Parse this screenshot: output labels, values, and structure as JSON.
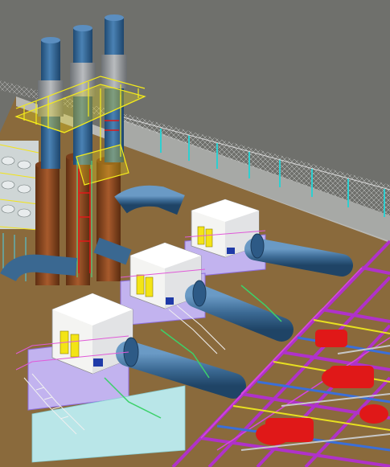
{
  "viewport": {
    "background": "#6f706c",
    "ground_color": "#8a6a3c",
    "wall_color": "#a7a9a6",
    "fence_color": "#2ecfd0",
    "stack_color": "#3a6b9a",
    "duct_color": "#3d6b95",
    "chimney_color": "#8a4a25",
    "enclosure_color": "#f4f4f2",
    "panel_color": "#f3e416",
    "handrail_color": "#f5ec1a",
    "skid_color": "#b7a1e6",
    "pipe_rack_color": "#b032c9",
    "red_equipment_color": "#e01818"
  },
  "scene": {
    "stacks": [
      "stack-1",
      "stack-2",
      "stack-3"
    ],
    "generator_units": [
      "unit-1",
      "unit-2",
      "unit-3"
    ]
  }
}
